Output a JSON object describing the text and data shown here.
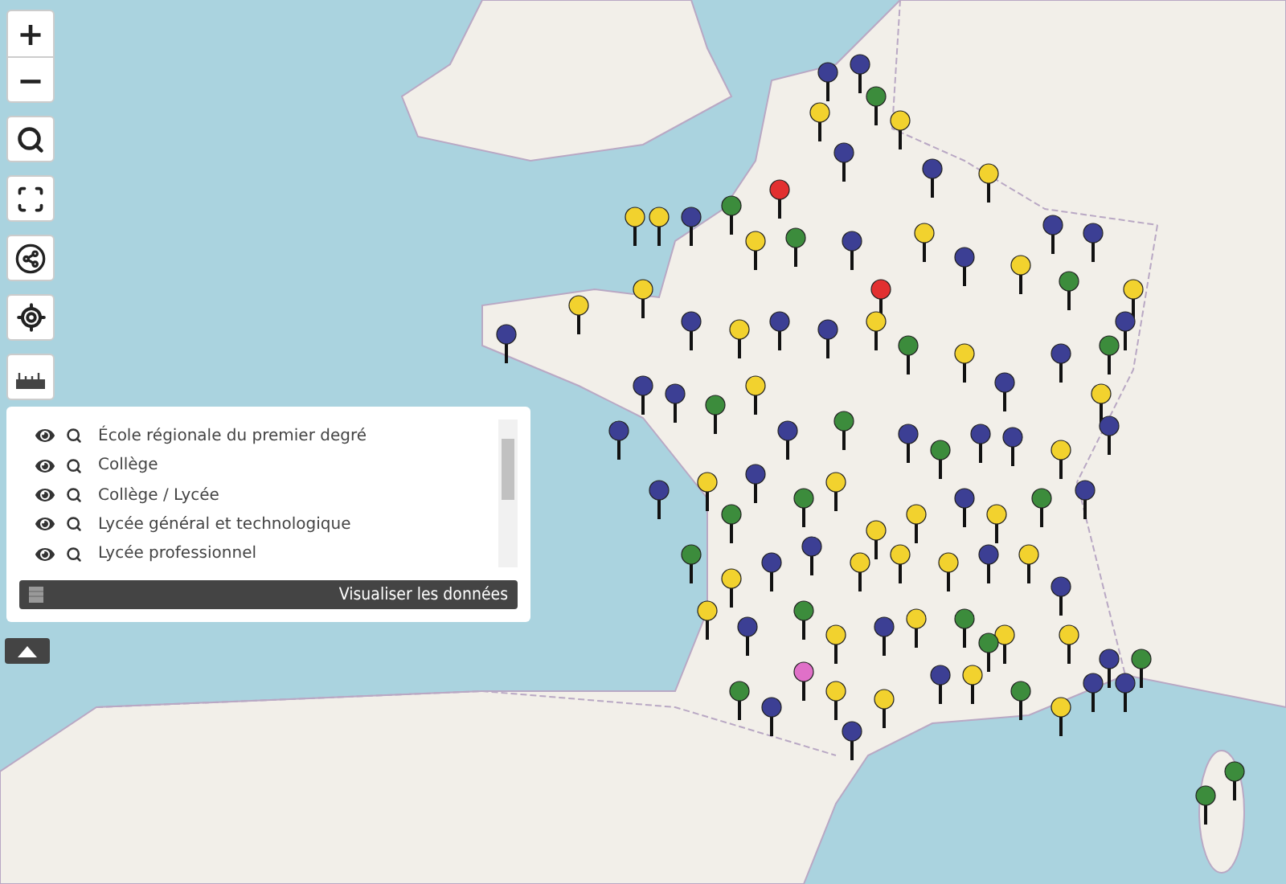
{
  "zoom_controls": {
    "zoom_in": "+",
    "zoom_out": "−"
  },
  "legend": {
    "items": [
      {
        "label": "École régionale du premier degré"
      },
      {
        "label": "Collège"
      },
      {
        "label": "Collège / Lycée"
      },
      {
        "label": "Lycée général et technologique"
      },
      {
        "label": "Lycée professionnel"
      }
    ],
    "data_button": "Visualiser les données"
  }
}
